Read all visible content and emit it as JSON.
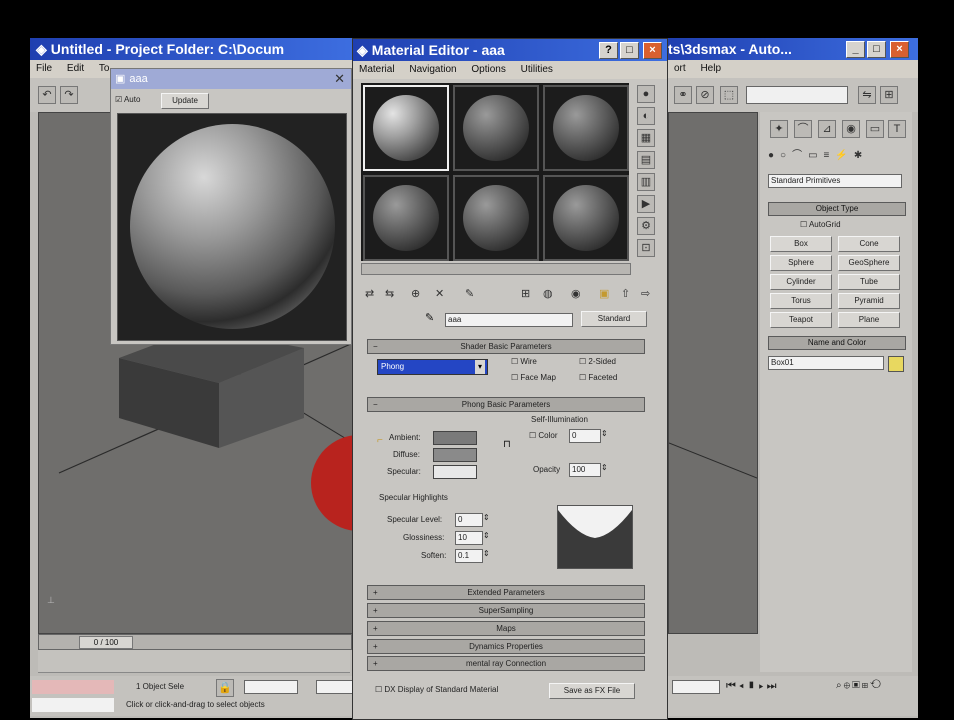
{
  "main_window": {
    "title": "Untitled    - Project Folder: C:\\Docum",
    "title_right": "ts\\3dsmax    - Auto...",
    "menu_left": [
      "File",
      "Edit",
      "To"
    ],
    "menu_right": [
      "ort",
      "Help"
    ]
  },
  "material_editor": {
    "title": "Material Editor - aaa",
    "menu": [
      "Material",
      "Navigation",
      "Options",
      "Utilities"
    ],
    "material_name": "aaa",
    "type_button": "Standard",
    "shader_rollout": "Shader Basic Parameters",
    "shader_type": "Phong",
    "shader_options": [
      "Wire",
      "2-Sided",
      "Face Map",
      "Faceted"
    ],
    "basic_rollout": "Phong Basic Parameters",
    "self_illumination_label": "Self-Illumination",
    "color_label": "Color",
    "color_value": "0",
    "opacity_label": "Opacity",
    "opacity_value": "100",
    "ambient_label": "Ambient:",
    "diffuse_label": "Diffuse:",
    "specular_label": "Specular:",
    "specular_highlights_label": "Specular Highlights",
    "specular_level_label": "Specular Level:",
    "specular_level_value": "0",
    "glossiness_label": "Glossiness:",
    "glossiness_value": "10",
    "soften_label": "Soften:",
    "soften_value": "0.1",
    "rollouts": [
      "Extended Parameters",
      "SuperSampling",
      "Maps",
      "Dynamics Properties",
      "mental ray Connection"
    ],
    "checkbox_label": "DX Display of Standard Material",
    "save_fx_button": "Save as FX File"
  },
  "preview_window": {
    "title": "aaa",
    "auto_label": "Auto",
    "update_label": "Update"
  },
  "command_panel": {
    "dropdown_value": "Standard Primitives",
    "object_type_rollout": "Object Type",
    "autogrid_label": "AutoGrid",
    "buttons": [
      "Box",
      "Cone",
      "Sphere",
      "GeoSphere",
      "Cylinder",
      "Tube",
      "Torus",
      "Pyramid",
      "Teapot",
      "Plane"
    ],
    "name_color_rollout": "Name and Color",
    "name_value": "Box01"
  },
  "status": {
    "frame_counter": "0 / 100",
    "selection_text": "1 Object Sele",
    "prompt_text": "Click or click-and-drag to select objects"
  },
  "colors": {
    "title_blue": "#2a52c8",
    "viewport_gray": "#6f6e6c",
    "panel_gray": "#c8c6c2",
    "teapot_red": "#b8231e",
    "shader_select_blue": "#2446c4"
  }
}
